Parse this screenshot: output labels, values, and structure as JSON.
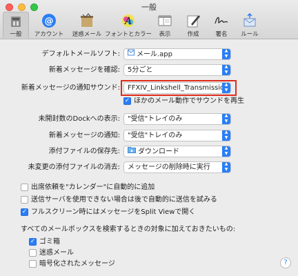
{
  "window": {
    "title": "一般"
  },
  "toolbar": {
    "items": [
      {
        "label": "一般",
        "icon": "general-icon",
        "selected": true
      },
      {
        "label": "アカウント",
        "icon": "at-sign-icon",
        "selected": false
      },
      {
        "label": "迷惑メール",
        "icon": "junk-mail-icon",
        "selected": false
      },
      {
        "label": "フォントとカラー",
        "icon": "fonts-colors-icon",
        "selected": false
      },
      {
        "label": "表示",
        "icon": "viewing-icon",
        "selected": false
      },
      {
        "label": "作成",
        "icon": "composing-icon",
        "selected": false
      },
      {
        "label": "署名",
        "icon": "signatures-icon",
        "selected": false
      },
      {
        "label": "ルール",
        "icon": "rules-icon",
        "selected": false
      }
    ]
  },
  "settings": {
    "default_mail": {
      "label": "デフォルトメールソフト:",
      "value": "メール.app"
    },
    "check_new": {
      "label": "新着メッセージを確認:",
      "value": "5分ごと"
    },
    "notify_sound": {
      "label": "新着メッセージの通知サウンド:",
      "value": "FFXIV_Linkshell_Transmission"
    },
    "play_other": {
      "label": "ほかのメール動作でサウンドを再生",
      "checked": true
    },
    "dock_unread": {
      "label": "未開封数のDockへの表示:",
      "value": "\"受信\"トレイのみ"
    },
    "new_notify": {
      "label": "新着メッセージの通知:",
      "value": "\"受信\"トレイのみ"
    },
    "download_folder": {
      "label": "添付ファイルの保存先:",
      "value": "ダウンロード"
    },
    "remove_downloads": {
      "label": "未変更の添付ファイルの消去:",
      "value": "メッセージの削除時に実行"
    }
  },
  "checkboxes": [
    {
      "label": "出席依頼を\"カレンダー\"に自動的に追加",
      "checked": false
    },
    {
      "label": "送信サーバを使用できない場合は後で自動的に送信を試みる",
      "checked": false
    },
    {
      "label": "フルスクリーン時にはメッセージをSplit Viewで開く",
      "checked": true
    }
  ],
  "search": {
    "heading": "すべてのメールボックスを検索するときの対象に加えておきたいもの:",
    "items": [
      {
        "label": "ゴミ箱",
        "checked": true
      },
      {
        "label": "迷惑メール",
        "checked": false
      },
      {
        "label": "暗号化されたメッセージ",
        "checked": false
      }
    ]
  },
  "help": {
    "label": "?"
  },
  "colors": {
    "accent": "#2a7ef7",
    "highlight": "#e02a1a"
  }
}
